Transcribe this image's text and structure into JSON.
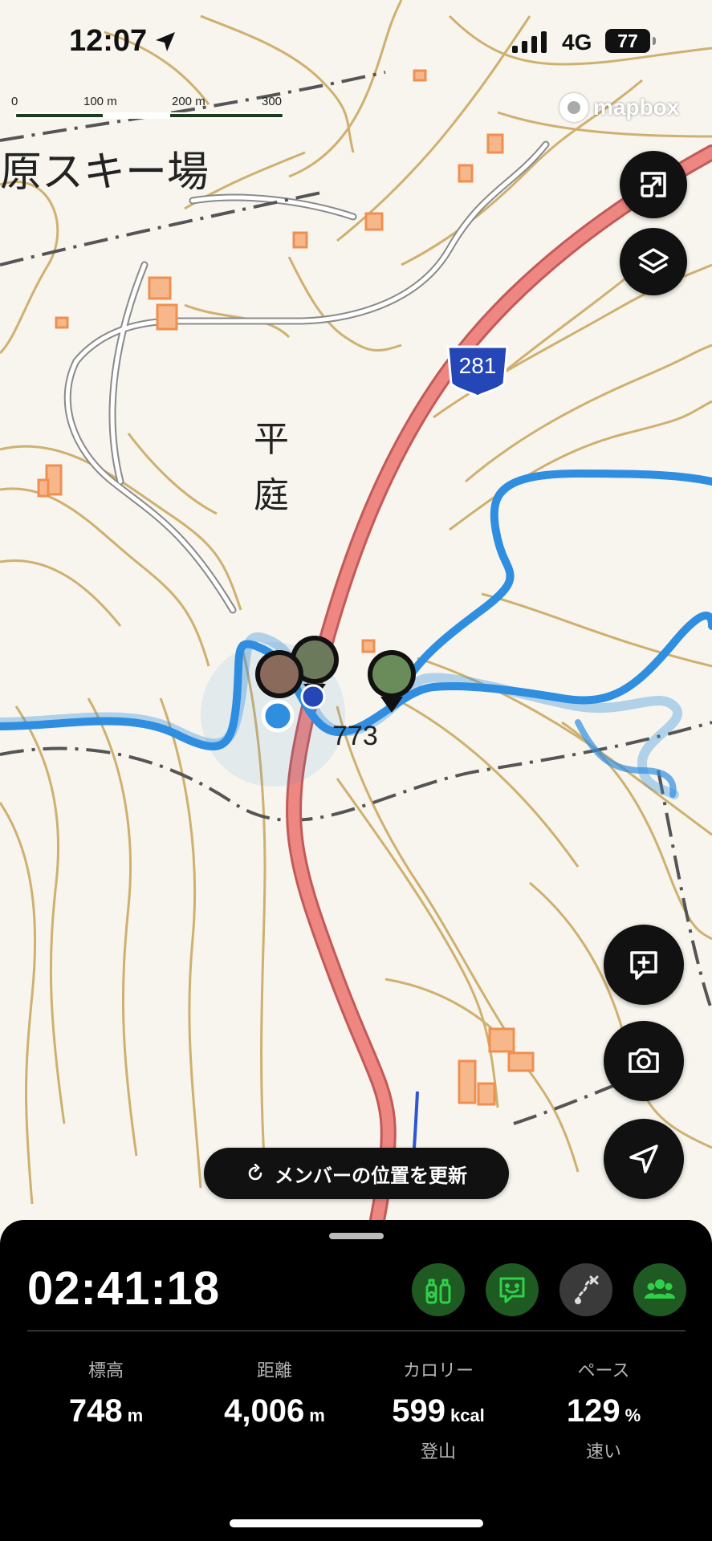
{
  "status_bar": {
    "time": "12:07",
    "network": "4G",
    "battery": "77"
  },
  "map": {
    "scale_labels": [
      "0",
      "100 m",
      "200 m",
      "300 m"
    ],
    "attribution": "mapbox",
    "labels": {
      "ski_area": "原スキー場",
      "place_1": "平",
      "place_2": "庭",
      "route_number": "281",
      "elevation_mark": "773"
    }
  },
  "controls": {
    "update_members": "メンバーの位置を更新",
    "icons": [
      "expand-icon",
      "layers-icon",
      "add-note-icon",
      "camera-icon",
      "navigate-icon"
    ]
  },
  "panel": {
    "elapsed": "02:41:18",
    "actions": [
      "gear-check-icon",
      "chat-icon",
      "route-icon",
      "group-icon"
    ],
    "stats": [
      {
        "label": "標高",
        "value": "748",
        "unit": "m",
        "sub": ""
      },
      {
        "label": "距離",
        "value": "4,006",
        "unit": "m",
        "sub": ""
      },
      {
        "label": "カロリー",
        "value": "599",
        "unit": "kcal",
        "sub": "登山"
      },
      {
        "label": "ペース",
        "value": "129",
        "unit": "%",
        "sub": "速い"
      }
    ]
  },
  "colors": {
    "contour": "#c9a45a",
    "track": "#2f8ee0",
    "road": "#e8706e",
    "building": "#f1a36a",
    "panel": "#000000",
    "accent_green": "#2fd14a"
  }
}
